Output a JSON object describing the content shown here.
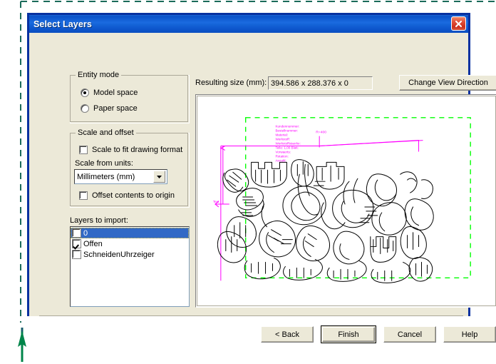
{
  "dialog": {
    "title": "Select Layers",
    "close_icon": "close-icon"
  },
  "entity_mode": {
    "group_label": "Entity mode",
    "options": [
      {
        "label": "Model space",
        "checked": true
      },
      {
        "label": "Paper space",
        "checked": false
      }
    ]
  },
  "scale_and_offset": {
    "group_label": "Scale and offset",
    "scale_to_fit": {
      "label": "Scale to fit drawing format",
      "checked": false
    },
    "scale_from_units_label": "Scale from units:",
    "units_value": "Millimeters (mm)",
    "units_dropdown_icon": "chevron-down-icon",
    "offset_to_origin": {
      "label": "Offset contents to origin",
      "checked": false
    }
  },
  "layers": {
    "label": "Layers to import:",
    "items": [
      {
        "name": "0",
        "checked": false,
        "selected": true
      },
      {
        "name": "Offen",
        "checked": true,
        "selected": false
      },
      {
        "name": "SchneidenUhrzeiger",
        "checked": false,
        "selected": false
      }
    ]
  },
  "preview": {
    "resulting_size_label": "Resulting size (mm):",
    "resulting_size_value": "394.586 x 288.376 x 0",
    "change_view_button": "Change View Direction",
    "colors": {
      "bounds": "#00ff00",
      "annotation": "#ff00ff",
      "geometry": "#000000",
      "canvas": "#ffffff"
    },
    "annotation_block_lines": [
      "Kundennummer:",
      "Bestellnummer:",
      "Material:",
      "Werkstoff:",
      "Werkstoffstaerke:",
      "Teile: 1,00 Blatt:",
      "Vorwaerts:",
      "Rotation:",
      "Anzahl:"
    ],
    "dimension_label": "R=400"
  },
  "footer": {
    "buttons": [
      {
        "label": "< Back",
        "default": false
      },
      {
        "label": "Finish",
        "default": true
      },
      {
        "label": "Cancel",
        "default": false
      },
      {
        "label": "Help",
        "default": false
      }
    ]
  },
  "annotations": {
    "guide_color": "#1a6b5a",
    "arrow_color": "#00854a",
    "arrow_icon": "arrow-up-icon"
  }
}
